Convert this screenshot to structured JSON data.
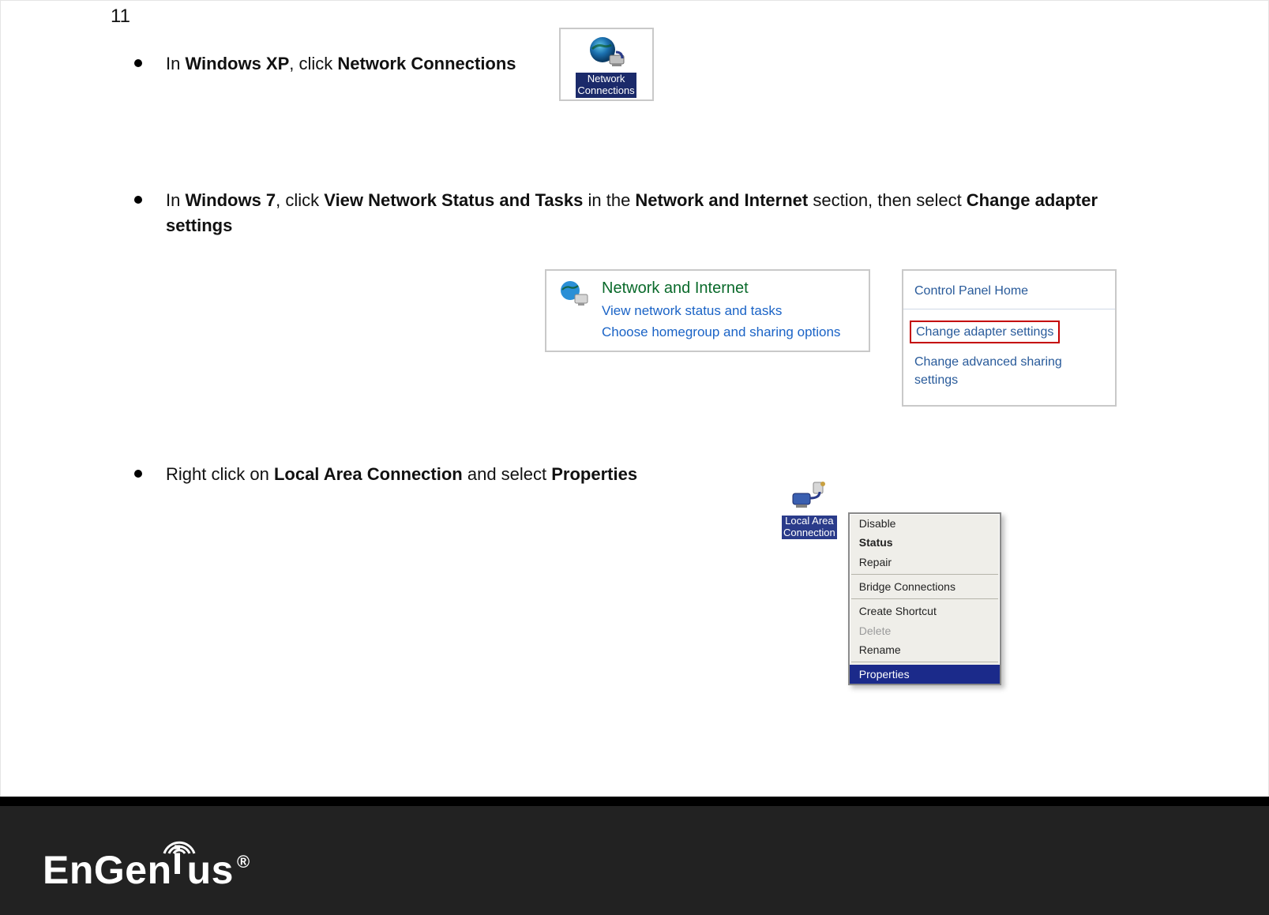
{
  "page_number": "11",
  "bullet1": {
    "prefix": "In ",
    "b1": "Windows XP",
    "mid": ", click ",
    "b2": "Network Connections",
    "tile_label_line1": "Network",
    "tile_label_line2": "Connections"
  },
  "bullet2": {
    "prefix": "In ",
    "b1": "Windows 7",
    "mid1": ", click ",
    "b2": "View Network Status and Tasks",
    "mid2": " in the ",
    "b3": "Network and Internet",
    "mid3": " section, then select ",
    "b4": "Change adapter settings"
  },
  "win7_panel_left": {
    "heading": "Network and Internet",
    "link1": "View network status and tasks",
    "link2": "Choose homegroup and sharing options"
  },
  "win7_panel_right": {
    "item1": "Control Panel Home",
    "item2_highlighted": "Change adapter settings",
    "item3": "Change advanced sharing settings"
  },
  "bullet3": {
    "prefix": "Right click on ",
    "b1": "Local Area Connection",
    "mid": " and select ",
    "b2": "Properties"
  },
  "lac": {
    "label_line1": "Local Area",
    "label_line2": "Connection"
  },
  "ctx_menu": {
    "disable": "Disable",
    "status": "Status",
    "repair": "Repair",
    "bridge": "Bridge Connections",
    "shortcut": "Create Shortcut",
    "delete": "Delete",
    "rename": "Rename",
    "properties": "Properties"
  },
  "footer": {
    "brand_left": "EnGen",
    "brand_right": "us",
    "reg": "®"
  }
}
